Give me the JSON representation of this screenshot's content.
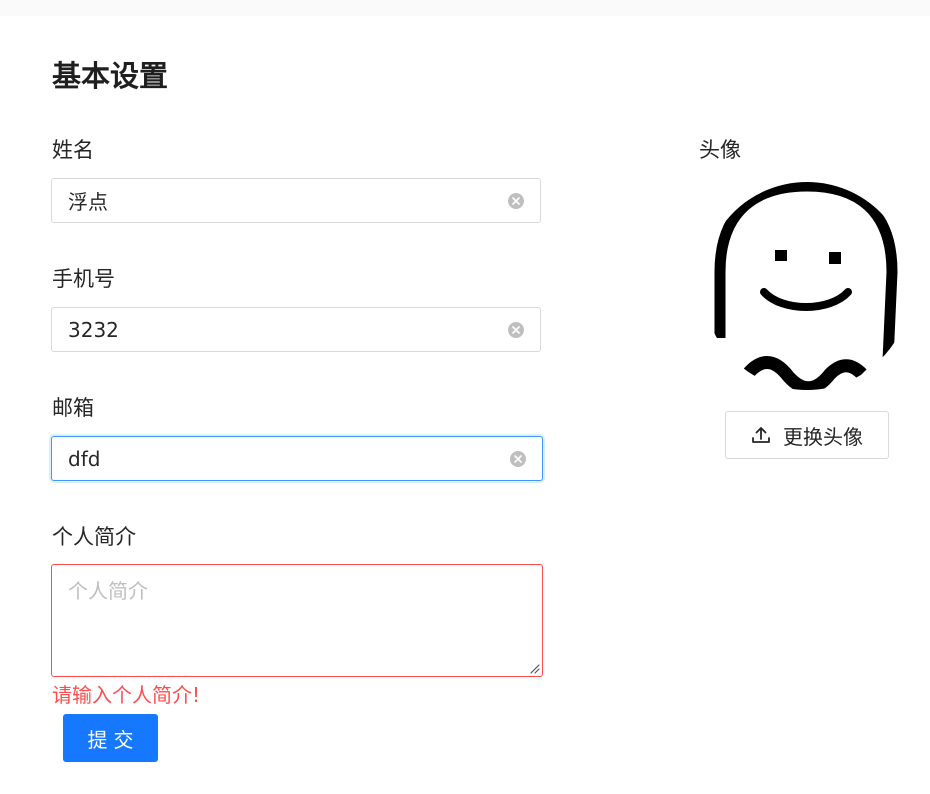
{
  "page": {
    "title": "基本设置"
  },
  "form": {
    "name": {
      "label": "姓名",
      "value": "浮点"
    },
    "phone": {
      "label": "手机号",
      "value": "3232"
    },
    "email": {
      "label": "邮箱",
      "value": "dfd"
    },
    "bio": {
      "label": "个人简介",
      "value": "",
      "placeholder": "个人简介",
      "error": "请输入个人简介!"
    },
    "submit_label": "提交"
  },
  "avatar": {
    "label": "头像",
    "change_label": "更换头像",
    "icon": "upload-icon"
  },
  "colors": {
    "primary": "#1677ff",
    "error": "#ff4d4f",
    "focus_border": "#4096ff"
  }
}
